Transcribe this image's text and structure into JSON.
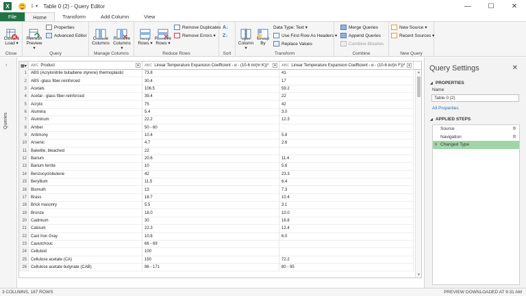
{
  "titlebar": {
    "logo_letter": "X",
    "quick_access_arrow": "⇩ ▾",
    "title": "Table 0 (2) - Query Editor",
    "minimize": "—",
    "maximize": "☐",
    "close": "✕"
  },
  "tabs": [
    "File",
    "Home",
    "Transform",
    "Add Column",
    "View"
  ],
  "ribbon": {
    "close_group": {
      "label": "Close",
      "close_load": "Close &\nLoad ▾"
    },
    "query_group": {
      "label": "Query",
      "refresh": "Refresh\nPreview ▾",
      "properties": "Properties",
      "advanced_editor": "Advanced Editor"
    },
    "manage_columns_group": {
      "label": "Manage Columns",
      "choose": "Choose\nColumns",
      "remove": "Remove\nColumns ▾"
    },
    "reduce_rows_group": {
      "label": "Reduce Rows",
      "keep": "Keep\nRows ▾",
      "remove": "Remove\nRows ▾",
      "remove_duplicates": "Remove Duplicates",
      "remove_errors": "Remove Errors ▾"
    },
    "sort_group": {
      "label": "Sort"
    },
    "transform_group": {
      "label": "Transform",
      "split": "Split\nColumn ▾",
      "group_by": "Group\nBy",
      "data_type": "Data Type: Text ▾",
      "first_row": "Use First Row As Headers ▾",
      "replace": "Replace Values"
    },
    "combine_group": {
      "label": "Combine",
      "merge": "Merge Queries",
      "append": "Append Queries",
      "combine_binaries": "Combine Binaries"
    },
    "new_query_group": {
      "label": "New Query",
      "new_source": "New Source ▾",
      "recent_sources": "Recent Sources ▾"
    }
  },
  "queries_pane": {
    "chevron": "›",
    "label": "Queries"
  },
  "grid": {
    "columns": [
      "Product",
      "Linear Temperature Expansion Coefficient - α - (10-6 m/(m K))*",
      "Linear Temperature Expansion Coefficient - α - (10-6 in/(in F))*"
    ],
    "rows": [
      [
        "1",
        "ABS (Acrylonitrile butadiene styrene) thermoplastic",
        "73.8",
        "41"
      ],
      [
        "2",
        "ABS -glass fiber-reinforced",
        "30.4",
        "17"
      ],
      [
        "3",
        "Acetals",
        "106.5",
        "59.2"
      ],
      [
        "4",
        "Acetal - glass fiber-reinforced",
        "39.4",
        "22"
      ],
      [
        "5",
        "Acrylic",
        "75",
        "42"
      ],
      [
        "6",
        "Alumina",
        "5.4",
        "3.0"
      ],
      [
        "7",
        "Aluminum",
        "22.2",
        "12.3"
      ],
      [
        "8",
        "Amber",
        "50 - 60",
        ""
      ],
      [
        "9",
        "Antimony",
        "10.4",
        "5.8"
      ],
      [
        "10",
        "Arsenic",
        "4.7",
        "2.6"
      ],
      [
        "11",
        "Bakelite, bleached",
        "22",
        ""
      ],
      [
        "12",
        "Barium",
        "20.6",
        "11.4"
      ],
      [
        "13",
        "Barium ferrite",
        "10",
        "5.6"
      ],
      [
        "14",
        "Benzocyclobutene",
        "42",
        "23.3"
      ],
      [
        "15",
        "Beryllium",
        "11.5",
        "6.4"
      ],
      [
        "16",
        "Bismuth",
        "13",
        "7.3"
      ],
      [
        "17",
        "Brass",
        "18.7",
        "10.4"
      ],
      [
        "18",
        "Brick masonry",
        "5.5",
        "3.1"
      ],
      [
        "19",
        "Bronze",
        "18.0",
        "10.0"
      ],
      [
        "20",
        "Cadmium",
        "30",
        "16.8"
      ],
      [
        "21",
        "Calcium",
        "22.3",
        "12.4"
      ],
      [
        "22",
        "Cast Iron Gray",
        "10.8",
        "6.0"
      ],
      [
        "23",
        "Caoutchouc",
        "66 - 69",
        ""
      ],
      [
        "24",
        "Celluloid",
        "100",
        ""
      ],
      [
        "25",
        "Cellulose acetate (CA)",
        "150",
        "72.2"
      ],
      [
        "26",
        "Cellulose acetate butynate (CAB)",
        "96 - 171",
        "80 - 95"
      ]
    ]
  },
  "query_settings": {
    "title": "Query Settings",
    "close": "✕",
    "properties_heading": "PROPERTIES",
    "name_label": "Name",
    "name_value": "Table 0 (2)",
    "all_properties": "All Properties",
    "applied_steps_heading": "APPLIED STEPS",
    "steps": [
      "Source",
      "Navigation",
      "Changed Type"
    ]
  },
  "statusbar": {
    "left": "3 COLUMNS, 187 ROWS",
    "right": "PREVIEW DOWNLOADED AT 9:31 AM"
  },
  "colors": {
    "accent": "#217346",
    "selected_step": "#9fd5a8",
    "link": "#2a6ebb"
  }
}
